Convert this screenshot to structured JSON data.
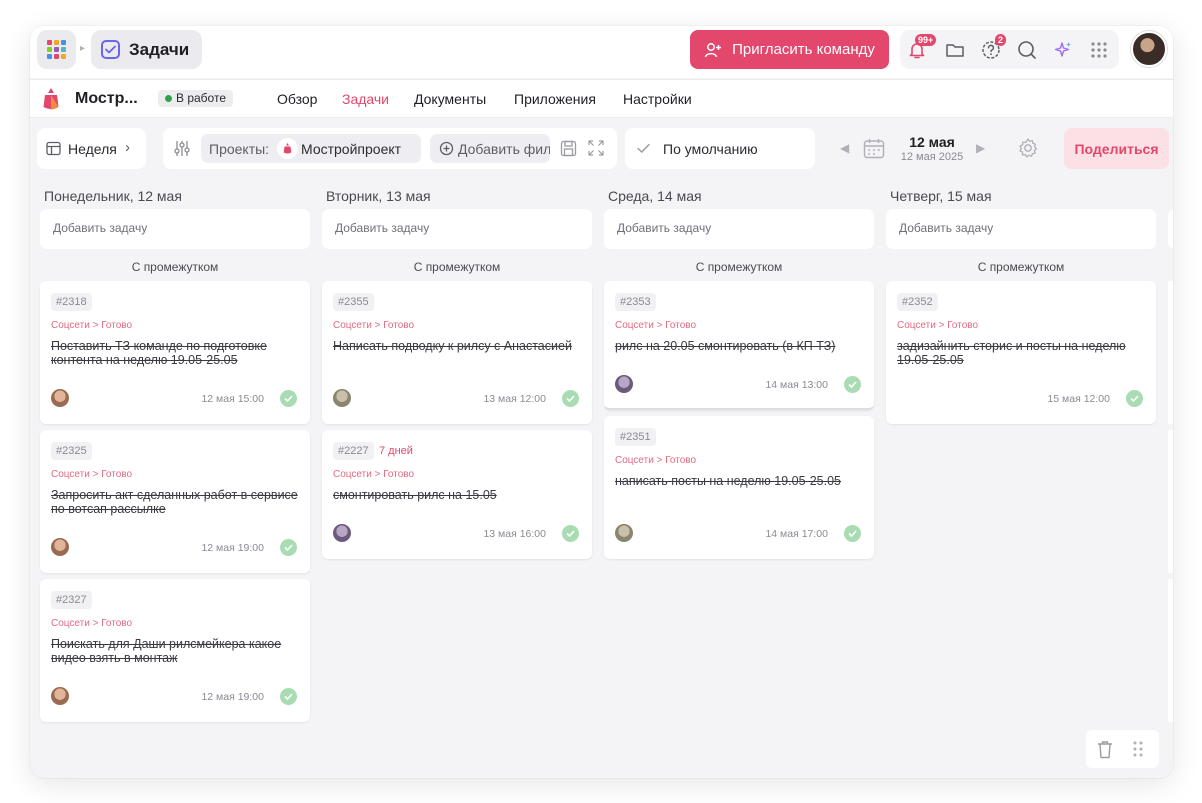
{
  "topbar": {
    "module_title": "Задачи",
    "invite_label": "Пригласить команду",
    "notifications_badge": "99+",
    "help_badge": "2",
    "accent": "#e3476c"
  },
  "project": {
    "name": "Мостр...",
    "status": "В работе",
    "tabs": [
      {
        "label": "Обзор"
      },
      {
        "label": "Задачи"
      },
      {
        "label": "Документы"
      },
      {
        "label": "Приложения"
      },
      {
        "label": "Настройки"
      }
    ],
    "active_tab": "Задачи"
  },
  "toolbar": {
    "view_label": "Неделя",
    "projects_label": "Проекты:",
    "project_chip": "Мостройпроект",
    "add_filter": "Добавить фил",
    "sort_label": "По умолчанию",
    "date_main": "12 мая",
    "date_sub": "12 мая 2025",
    "share_label": "Поделиться"
  },
  "board": {
    "add_task_label": "Добавить задачу",
    "gap_label": "С промежутком",
    "columns": [
      {
        "title": "Понедельник, 12 мая",
        "cards": [
          {
            "id": "#2318",
            "path": "Соцсети > Готово",
            "title": "Поставить ТЗ команде по подготовке контента на неделю 19.05-25.05",
            "time": "12 мая 15:00"
          },
          {
            "id": "#2325",
            "path": "Соцсети > Готово",
            "title": "Запросить акт сделанных работ в сервисе по вотсап рассылке",
            "time": "12 мая 19:00"
          },
          {
            "id": "#2327",
            "path": "Соцсети > Готово",
            "title": "Поискать для Даши рилсмейкера какое видео взять в монтаж",
            "time": "12 мая 19:00"
          }
        ]
      },
      {
        "title": "Вторник, 13 мая",
        "cards": [
          {
            "id": "#2355",
            "path": "Соцсети > Готово",
            "title": "Написать подводку к рилсу с Анастасией",
            "time": "13 мая 12:00"
          },
          {
            "id": "#2227",
            "overdue": "7 дней",
            "path": "Соцсети > Готово",
            "title": "смонтировать рилс на 15.05",
            "time": "13 мая 16:00"
          }
        ]
      },
      {
        "title": "Среда, 14 мая",
        "cards": [
          {
            "id": "#2353",
            "path": "Соцсети > Готово",
            "title": "рилс на 20.05 смонтировать (в КП ТЗ)",
            "time": "14 мая 13:00"
          },
          {
            "id": "#2351",
            "path": "Соцсети > Готово",
            "title": "написать посты на неделю 19.05-25.05",
            "time": "14 мая 17:00"
          }
        ]
      },
      {
        "title": "Четверг, 15 мая",
        "cards": [
          {
            "id": "#2352",
            "path": "Соцсети > Готово",
            "title": "задизайнить сторис и посты на неделю 19.05-25.05",
            "time": "15 мая 12:00"
          }
        ]
      }
    ]
  }
}
